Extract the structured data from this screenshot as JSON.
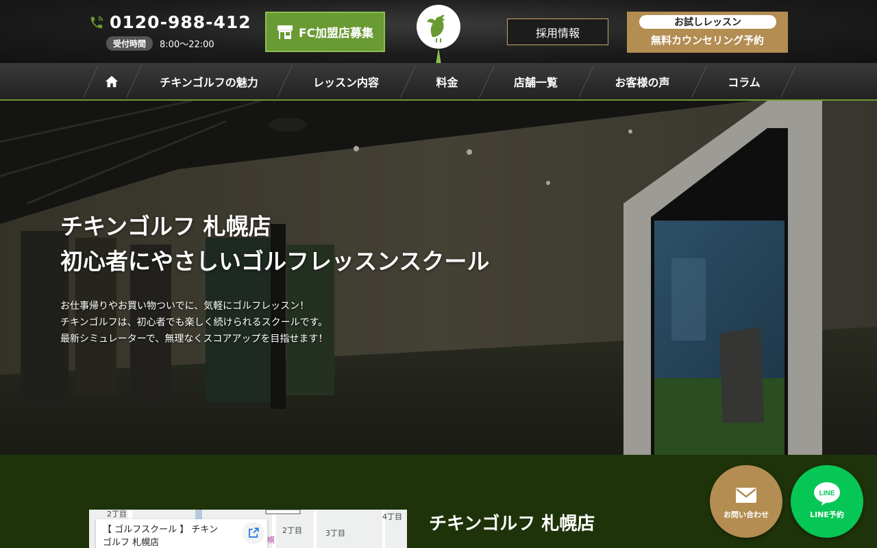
{
  "header": {
    "phone_number": "0120-988-412",
    "hours_label": "受付時間",
    "hours_value": "8:00～22:00",
    "fc_button": "FC加盟店募集",
    "recruit_button": "採用情報",
    "trial_pill": "お試しレッスン",
    "trial_sub": "無料カウンセリング予約"
  },
  "nav": {
    "items": [
      {
        "label": "チキンゴルフの魅力"
      },
      {
        "label": "レッスン内容"
      },
      {
        "label": "料金"
      },
      {
        "label": "店舗一覧"
      },
      {
        "label": "お客様の声"
      },
      {
        "label": "コラム"
      }
    ]
  },
  "hero": {
    "title_line1": "チキンゴルフ 札幌店",
    "title_line2": "初心者にやさしいゴルフレッスンスクール",
    "desc_line1": "お仕事帰りやお買い物ついでに、気軽にゴルフレッスン！",
    "desc_line2": "チキンゴルフは、初心者でも楽しく続けられるスクールです。",
    "desc_line3": "最新シミュレーターで、無理なくスコアアップを目指せます！"
  },
  "store": {
    "name": "チキンゴルフ 札幌店",
    "map_card_line1": "【 ゴルフスクール 】 チキン",
    "map_card_line2": "ゴルフ 札幌店",
    "map_labels": [
      "2丁目",
      "2丁目",
      "3丁目",
      "4丁目",
      "幌"
    ]
  },
  "floating": {
    "contact_label": "お問い合わせ",
    "line_label": "LINE予約",
    "line_logo_text": "LINE"
  },
  "colors": {
    "brand_green": "#6a9a34",
    "gold": "#b38d52",
    "line_green": "#06c755",
    "dark_green_bg": "#1e3309"
  }
}
